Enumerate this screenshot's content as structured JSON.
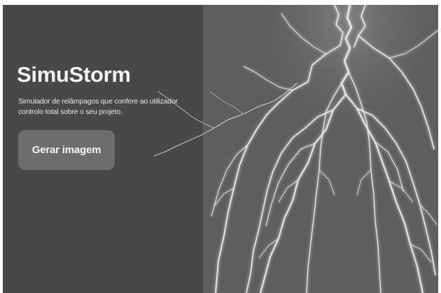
{
  "hero": {
    "title": "SimuStorm",
    "description": "Simulador de relâmpagos que confere ao utilizador controlo total sobre o seu projeto.",
    "button_label": "Gerar imagem"
  },
  "image": {
    "subject": "lightning-bolts"
  },
  "colors": {
    "left_panel": "#484848",
    "right_panel": "#5e5e5e",
    "button_bg": "#6d6d6d",
    "text": "#f2f2f2"
  }
}
